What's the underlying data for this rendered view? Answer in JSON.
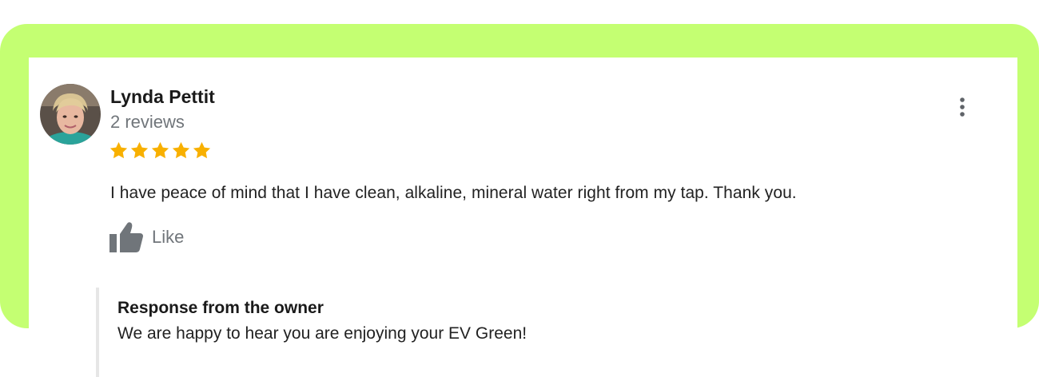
{
  "colors": {
    "frame_accent": "#c4ff72",
    "star": "#f8b000",
    "muted_text": "#70757a"
  },
  "review": {
    "reviewer_name": "Lynda Pettit",
    "review_count": "2 reviews",
    "rating": 5,
    "rating_max": 5,
    "text": "I have peace of mind that I have clean, alkaline, mineral water right from my tap.  Thank you.",
    "like_label": "Like",
    "more_icon": "more-vert-icon",
    "like_icon": "thumbs-up-icon"
  },
  "owner_response": {
    "title": "Response from the owner",
    "text": "We are happy to hear you are enjoying your EV Green!"
  }
}
